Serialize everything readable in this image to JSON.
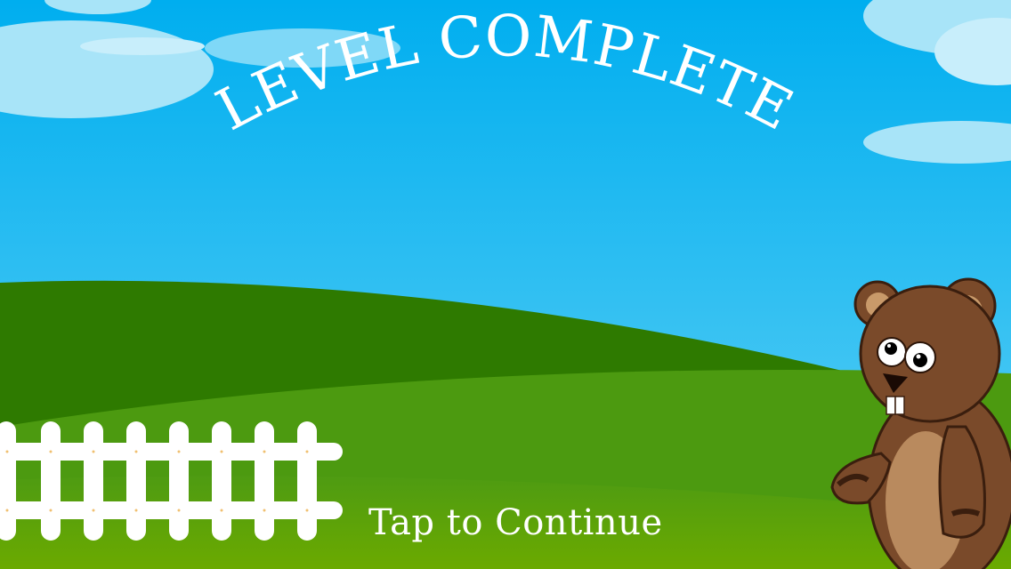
{
  "screen": {
    "title": "LEVEL COMPLETE",
    "tap_prompt": "Tap to Continue"
  },
  "colors": {
    "sky_top": "#00AEEF",
    "sky_bottom": "#5FD0F5",
    "cloud": "#A8E4F8",
    "hill_back": "#2E7A00",
    "hill_front": "#4C9A10",
    "ground": "#66A800",
    "fence": "#FFFFFF",
    "bear_fur": "#7A4A2A",
    "bear_belly": "#B98A5E"
  },
  "characters": [
    "beaver"
  ],
  "decorations": [
    "clouds",
    "hills",
    "picket-fence"
  ]
}
